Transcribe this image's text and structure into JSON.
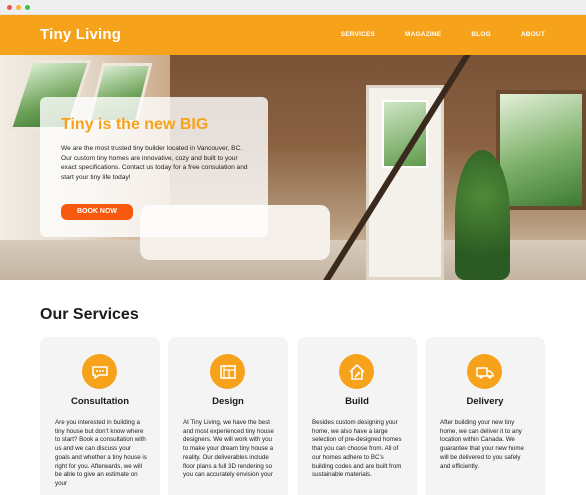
{
  "browser": {
    "controls": [
      "close",
      "minimize",
      "maximize"
    ]
  },
  "nav": {
    "brand": "Tiny Living",
    "links": [
      "SERVICES",
      "MAGAZINE",
      "BLOG",
      "ABOUT"
    ]
  },
  "hero": {
    "title": "Tiny is the new BIG",
    "text": "We are  the most trusted tiny builder located in Vancouver, BC. Our custom tiny homes are innovative, cozy and built to your exact specifications. Contact us today for a free consulation and start your tiny life today!",
    "button": "BOOK NOW"
  },
  "services": {
    "title": "Our Services",
    "cards": [
      {
        "icon": "chat-bubble-icon",
        "title": "Consultation",
        "text": "Are you interested in building a tiny house but don’t know where to start? Book a consultation with us and we can discuss your goals and whether a tiny house is right for you. Afterwards, we will be able to give an estimate on your"
      },
      {
        "icon": "blueprint-icon",
        "title": "Design",
        "text": "At Tiny Living, we have the best and most experienced tiny house designers. We will work with you to make your dream tiny house a reality. Our deliverables include floor plans a full 3D rendering so you can accurately envision your"
      },
      {
        "icon": "house-hammer-icon",
        "title": "Build",
        "text": "Besides custom designing your home, we also have a large selection of pre-designed homes that you can choose from. All of our homes adhere to BC’s building codes and are built from sustainable materials."
      },
      {
        "icon": "delivery-truck-icon",
        "title": "Delivery",
        "text": "After building your new tiny home, we can deliver it to any location within Canada. We guarantee that your new home will be delivered to you safely and efficiently."
      }
    ]
  },
  "colors": {
    "accent": "#f7a21b",
    "button": "#f7590f"
  }
}
